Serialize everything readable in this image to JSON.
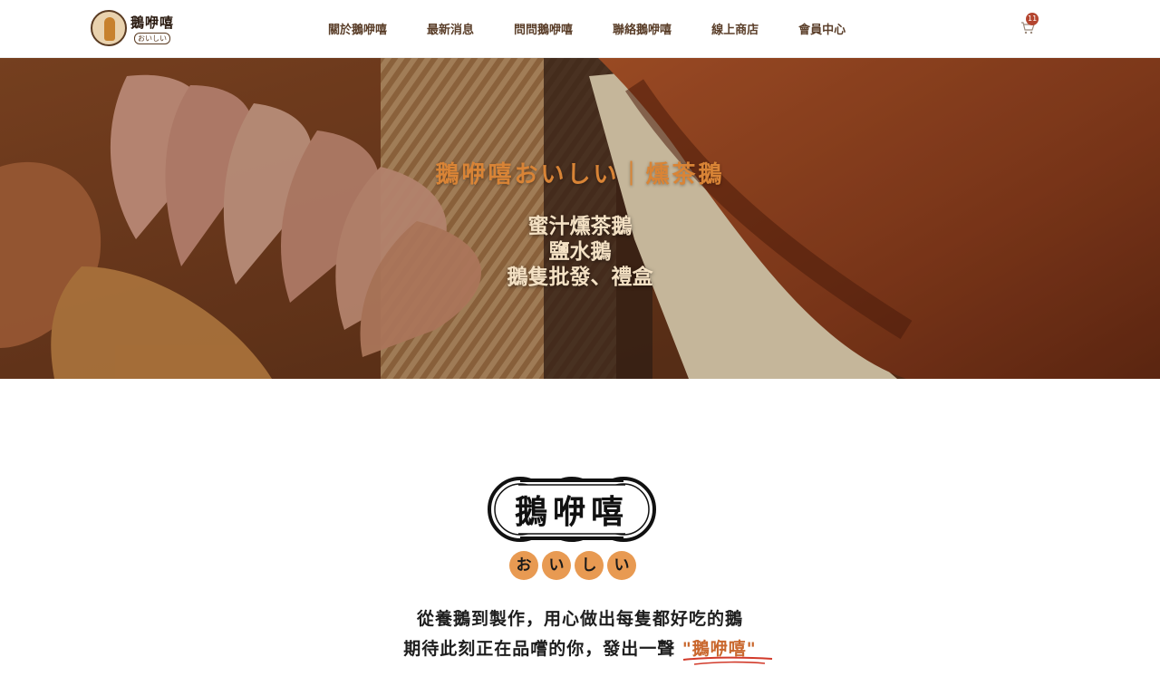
{
  "header": {
    "logo": {
      "main": "鵝咿嘻",
      "sub": "おいしい"
    },
    "nav": [
      "關於鵝咿嘻",
      "最新消息",
      "問問鵝咿嘻",
      "聯絡鵝咿嘻",
      "線上商店",
      "會員中心"
    ],
    "cart": {
      "icon": "cart-icon",
      "count": "11"
    }
  },
  "hero": {
    "title": "鵝咿嘻おいしい｜燻茶鵝",
    "lines": [
      "蜜汁燻茶鵝",
      "鹽水鵝",
      "鵝隻批發、禮盒"
    ]
  },
  "brand": {
    "name": "鵝咿嘻",
    "kana": [
      "お",
      "い",
      "し",
      "い"
    ]
  },
  "tagline": {
    "line1": "從養鵝到製作，用心做出每隻都好吃的鵝",
    "line2_prefix": "期待此刻正在品嚐的你，發出一聲",
    "line2_highlight": "\"鵝咿嘻\""
  },
  "colors": {
    "accent_orange": "#d98436",
    "nav_brown": "#5b3f2a",
    "badge_red": "#b4452f",
    "underline_red": "#d23b2b"
  }
}
